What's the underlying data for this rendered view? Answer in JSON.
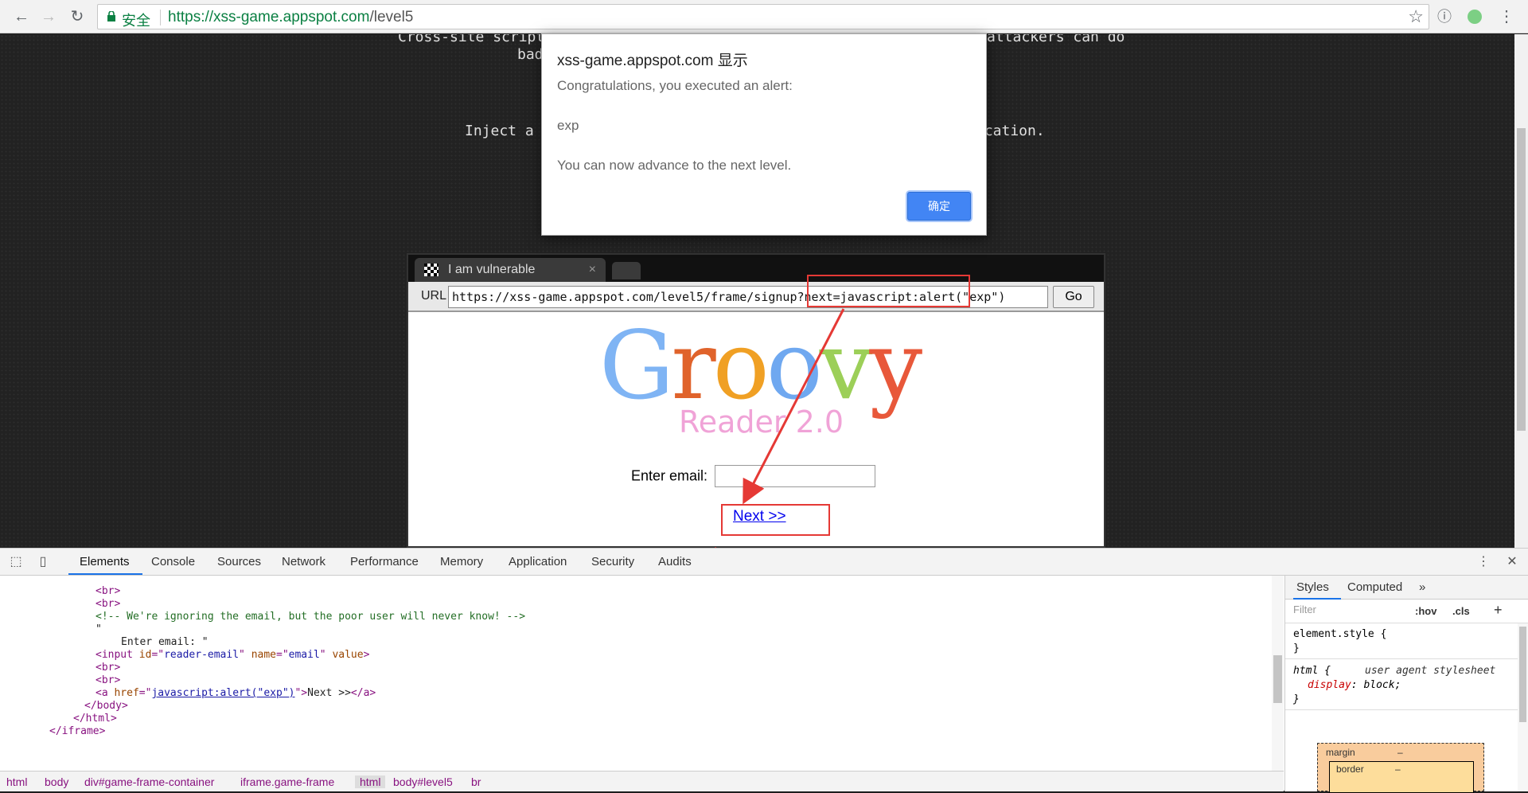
{
  "browser": {
    "secure_label": "安全",
    "url_host": "https://xss-game.appspot.com",
    "url_path": "/level5"
  },
  "page": {
    "intro_line1": "Cross-site scripti",
    "intro_line1_end": "attackers can do",
    "intro_line2_start": "bad",
    "intro_line3_start": "Inject a s",
    "intro_line3_end": "ication."
  },
  "game_frame": {
    "tab_title": "I am vulnerable",
    "tab_close": "×",
    "url_label": "URL",
    "url_value": "https://xss-game.appspot.com/level5/frame/signup?next=javascript:alert(\"exp\")",
    "go_label": "Go",
    "logo_letters": [
      {
        "ch": "G",
        "color": "#7fb4f4"
      },
      {
        "ch": "r",
        "color": "#e0632b"
      },
      {
        "ch": "o",
        "color": "#f0a024"
      },
      {
        "ch": "o",
        "color": "#6fa8f0"
      },
      {
        "ch": "v",
        "color": "#9ccf58"
      },
      {
        "ch": "y",
        "color": "#e8583a"
      }
    ],
    "logo_subtitle": "Reader 2.0",
    "email_label": "Enter email:",
    "next_link": "Next >>"
  },
  "dialog": {
    "title": "xss-game.appspot.com 显示",
    "message1": "Congratulations, you executed an alert:",
    "message2": "exp",
    "message3": "You can now advance to the next level.",
    "ok_label": "确定"
  },
  "devtools": {
    "tabs": [
      "Elements",
      "Console",
      "Sources",
      "Network",
      "Performance",
      "Memory",
      "Application",
      "Security",
      "Audits"
    ],
    "active_tab": "Elements",
    "dom_lines": [
      {
        "indent": 120,
        "parts": [
          {
            "c": "tag",
            "t": "<br>"
          }
        ]
      },
      {
        "indent": 120,
        "parts": [
          {
            "c": "tag",
            "t": "<br>"
          }
        ]
      },
      {
        "indent": 120,
        "parts": [
          {
            "c": "cmt",
            "t": "<!-- We're ignoring the email, but the poor user will never know! -->"
          }
        ]
      },
      {
        "indent": 120,
        "parts": [
          {
            "c": "txt",
            "t": "\""
          }
        ]
      },
      {
        "indent": 152,
        "parts": [
          {
            "c": "txt",
            "t": "Enter email: \""
          }
        ]
      },
      {
        "indent": 120,
        "parts": [
          {
            "c": "tag",
            "t": "<input "
          },
          {
            "c": "attr",
            "t": "id"
          },
          {
            "c": "tag",
            "t": "=\""
          },
          {
            "c": "val",
            "t": "reader-email"
          },
          {
            "c": "tag",
            "t": "\" "
          },
          {
            "c": "attr",
            "t": "name"
          },
          {
            "c": "tag",
            "t": "=\""
          },
          {
            "c": "val",
            "t": "email"
          },
          {
            "c": "tag",
            "t": "\" "
          },
          {
            "c": "attr",
            "t": "value"
          },
          {
            "c": "tag",
            "t": ">"
          }
        ]
      },
      {
        "indent": 120,
        "parts": [
          {
            "c": "tag",
            "t": "<br>"
          }
        ]
      },
      {
        "indent": 120,
        "parts": [
          {
            "c": "tag",
            "t": "<br>"
          }
        ]
      },
      {
        "indent": 120,
        "parts": [
          {
            "c": "tag",
            "t": "<a "
          },
          {
            "c": "attr",
            "t": "href"
          },
          {
            "c": "tag",
            "t": "=\""
          },
          {
            "c": "val",
            "t": "javascript:alert(\"exp\")"
          },
          {
            "c": "tag",
            "t": "\">"
          },
          {
            "c": "txt",
            "t": "Next >>"
          },
          {
            "c": "tag",
            "t": "</a>"
          }
        ]
      },
      {
        "indent": 106,
        "parts": [
          {
            "c": "tag",
            "t": "</body>"
          }
        ]
      },
      {
        "indent": 92,
        "parts": [
          {
            "c": "tag",
            "t": "</html>"
          }
        ]
      },
      {
        "indent": 62,
        "parts": [
          {
            "c": "tag",
            "t": "</iframe>"
          }
        ]
      }
    ],
    "breadcrumbs": [
      "html",
      "body",
      "div#game-frame-container",
      "iframe.game-frame",
      "html",
      "body#level5",
      "br"
    ],
    "selected_crumb": "html",
    "styles_tabs": [
      "Styles",
      "Computed",
      "»"
    ],
    "filter_placeholder": "Filter",
    "hov": ":hov",
    "cls": ".cls",
    "plus": "+",
    "css": {
      "element_style_open": "element.style {",
      "element_style_close": "}",
      "html_open": "html {",
      "html_source": "user agent stylesheet",
      "html_prop": "display",
      "html_value": ": block;",
      "html_close": "}"
    },
    "boxmodel": {
      "margin_label": "margin",
      "margin_value": "–",
      "border_label": "border",
      "border_value": "–"
    }
  },
  "colors": {
    "annotation_red": "#e53935",
    "ok_button": "#4285f4",
    "secure_green": "#0b8043"
  }
}
